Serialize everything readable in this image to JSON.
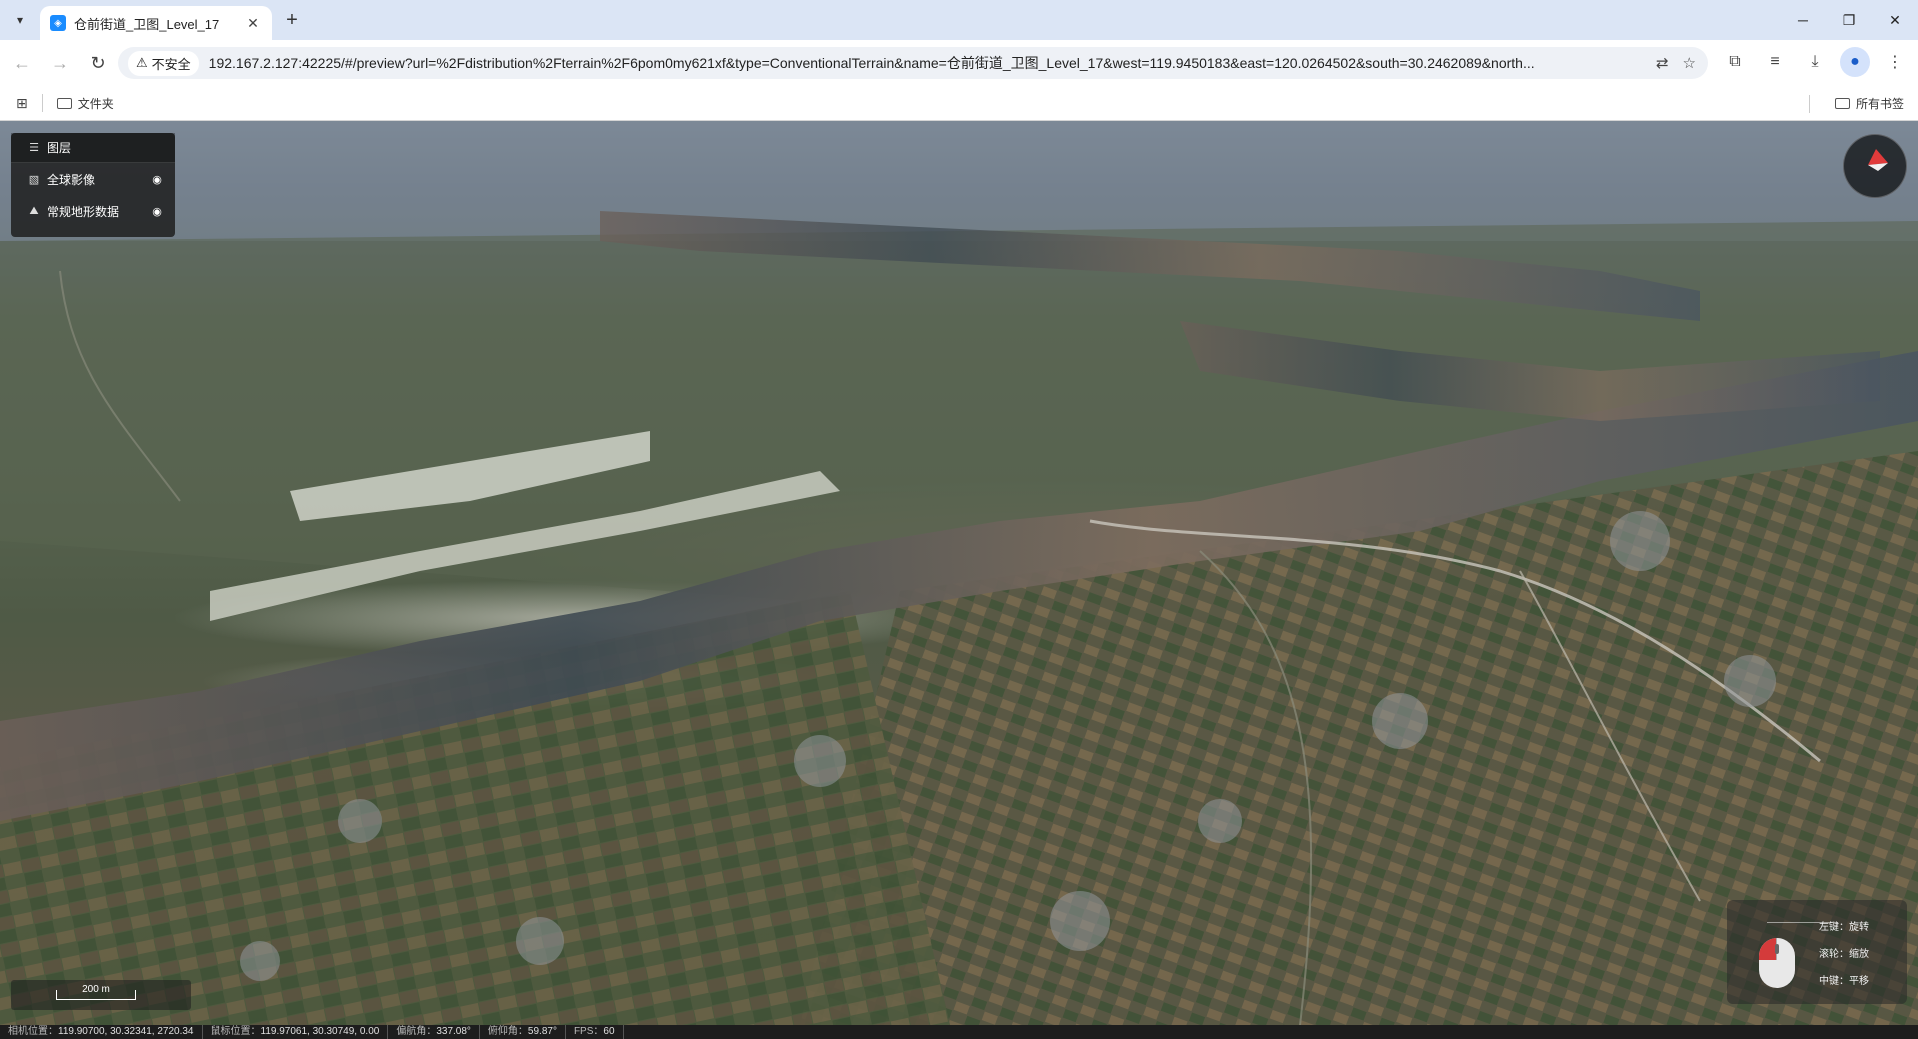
{
  "tab": {
    "title": "仓前街道_卫图_Level_17"
  },
  "address": {
    "security_label": "不安全",
    "url": "192.167.2.127:42225/#/preview?url=%2Fdistribution%2Fterrain%2F6pom0my621xf&type=ConventionalTerrain&name=仓前街道_卫图_Level_17&west=119.9450183&east=120.0264502&south=30.2462089&north..."
  },
  "bookmarks": {
    "folder": "文件夹",
    "all_bookmarks": "所有书签"
  },
  "layers": {
    "title": "图层",
    "items": [
      {
        "label": "全球影像"
      },
      {
        "label": "常规地形数据"
      }
    ]
  },
  "mouse_help": {
    "left": "左键：旋转",
    "wheel": "滚轮：缩放",
    "middle": "中键：平移"
  },
  "scale": {
    "label": "200 m"
  },
  "status": {
    "camera_label": "相机位置：",
    "camera_value": "119.90700, 30.32341, 2720.34",
    "mouse_label": "鼠标位置：",
    "mouse_value": "119.97061, 30.30749, 0.00",
    "heading_label": "偏航角：",
    "heading_value": "337.08°",
    "pitch_label": "俯仰角：",
    "pitch_value": "59.87°",
    "fps_label": "FPS：",
    "fps_value": "60"
  },
  "colors": {
    "accent": "#1a8cff",
    "compass_red": "#e03b3b",
    "panel_bg": "#1e1e1e"
  }
}
